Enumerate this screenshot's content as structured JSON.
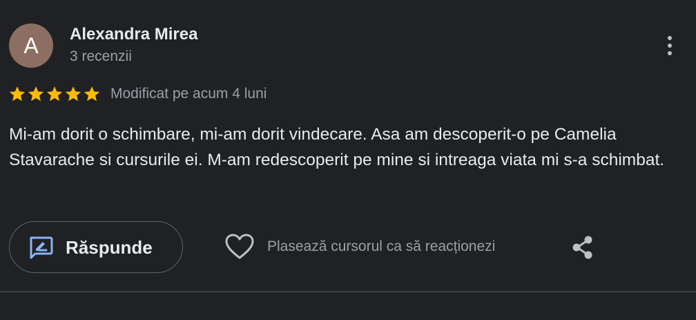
{
  "review": {
    "author": {
      "initial": "A",
      "name": "Alexandra Mirea",
      "meta": "3 recenzii",
      "avatar_color": "#8d6e63"
    },
    "rating": {
      "value": 5,
      "max": 5,
      "star_color": "#fbbc04",
      "date": "Modificat pe acum 4 luni"
    },
    "text": "Mi-am dorit o schimbare, mi-am dorit vindecare. Asa am descoperit-o pe Camelia Stavarache si cursurile ei. M-am redescoperit pe mine si intreaga viata mi s-a schimbat.",
    "actions": {
      "reply_label": "Răspunde",
      "reply_icon": "reply-edit-icon",
      "react_label": "Plasează cursorul ca să reacționezi",
      "react_icon": "heart-icon",
      "share_icon": "share-icon",
      "more_icon": "more-vert-icon"
    },
    "accent_color": "#8ab4f8"
  }
}
